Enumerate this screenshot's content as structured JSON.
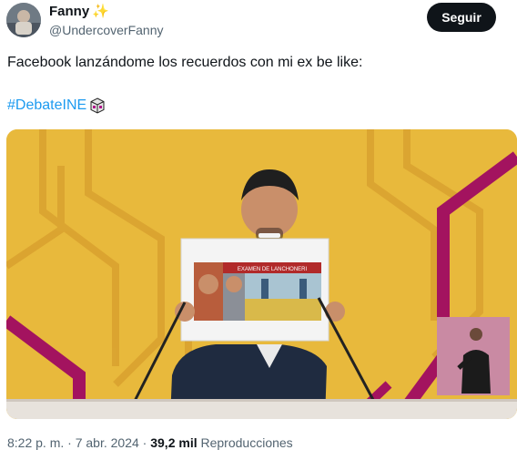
{
  "author": {
    "name": "Fanny",
    "emoji": "✨",
    "handle": "@UndercoverFanny"
  },
  "follow_label": "Seguir",
  "tweet": {
    "text": "Facebook lanzándome los recuerdos con mi ex be like:",
    "hashtag": "#DebateINE"
  },
  "media": {
    "sign_title": "EXAMEN DE LANCHONERI",
    "icons": [
      "ballot-box-icon"
    ]
  },
  "meta": {
    "time": "8:22 p. m.",
    "separator1": " · ",
    "date": "7 abr. 2024",
    "separator2": " · ",
    "views_count": "39,2 mil",
    "views_label": " Reproducciones"
  },
  "colors": {
    "accent": "#1d9bf0",
    "follow_bg": "#0f1419",
    "media_bg": "#e8b93c",
    "media_stripe": "#a3135f"
  }
}
